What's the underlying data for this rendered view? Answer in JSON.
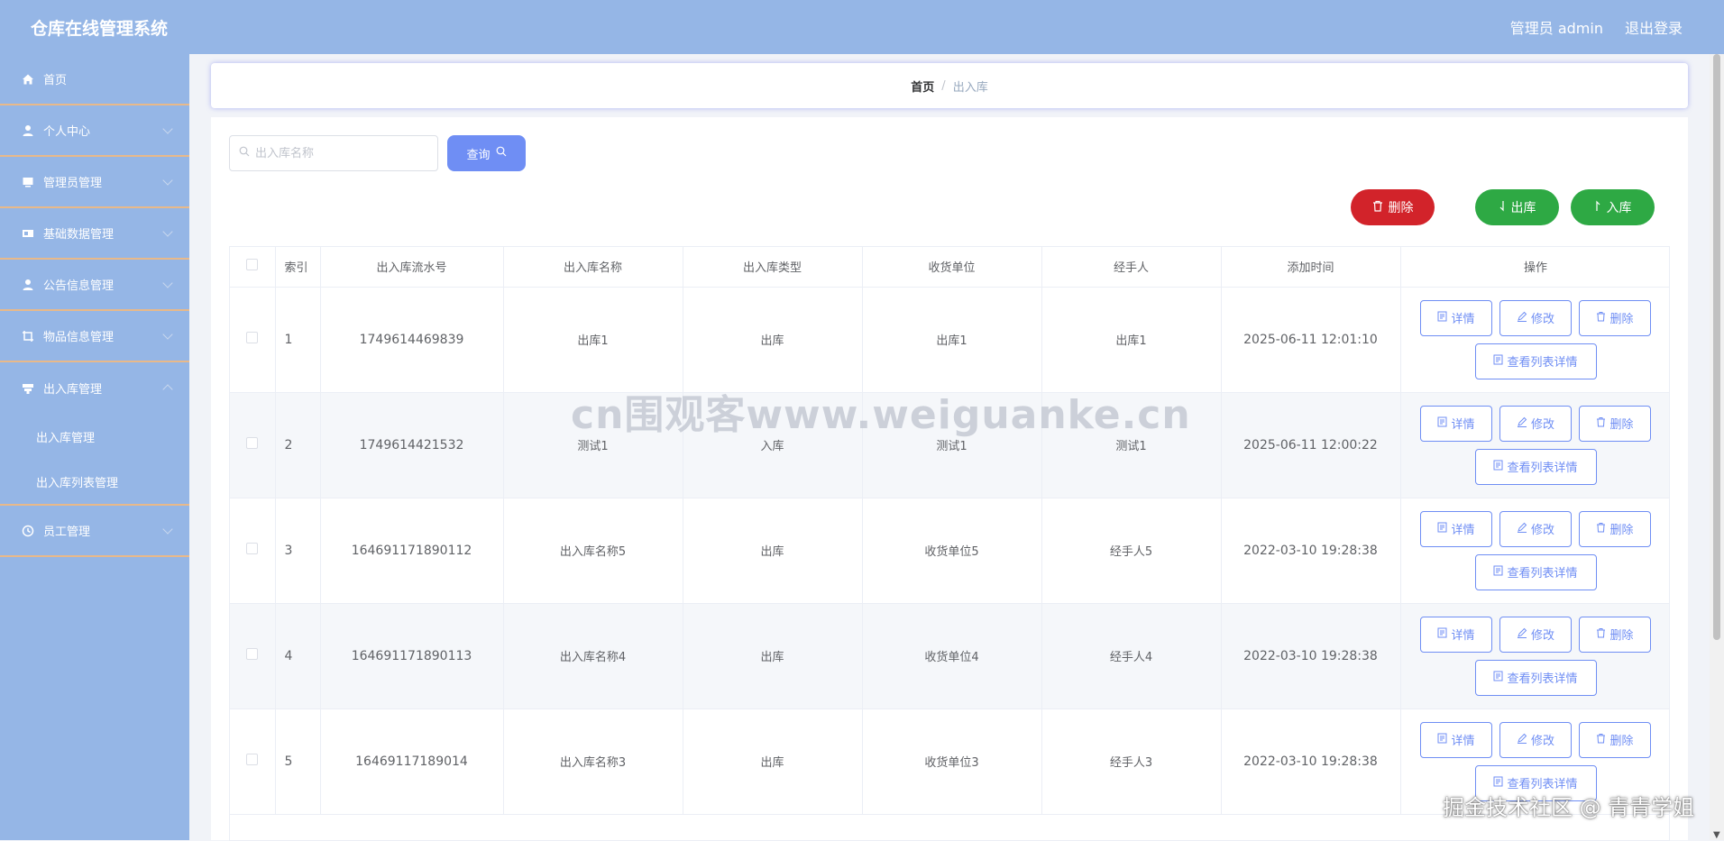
{
  "header": {
    "title": "仓库在线管理系统",
    "user": "管理员 admin",
    "logout": "退出登录"
  },
  "sidebar": {
    "items": [
      {
        "label": "首页",
        "icon": "home-icon"
      },
      {
        "label": "个人中心",
        "icon": "user-icon"
      },
      {
        "label": "管理员管理",
        "icon": "monitor-icon"
      },
      {
        "label": "基础数据管理",
        "icon": "film-icon"
      },
      {
        "label": "公告信息管理",
        "icon": "user-icon"
      },
      {
        "label": "物品信息管理",
        "icon": "crop-icon"
      },
      {
        "label": "出入库管理",
        "icon": "bank-icon"
      },
      {
        "label": "员工管理",
        "icon": "clock-icon"
      }
    ],
    "submenu": [
      "出入库管理",
      "出入库列表管理"
    ]
  },
  "breadcrumb": {
    "home": "首页",
    "separator": "/",
    "current": "出入库"
  },
  "search": {
    "placeholder": "出入库名称",
    "button": "查询"
  },
  "actions": {
    "delete": "删除",
    "outbound": "出库",
    "inbound": "入库"
  },
  "table": {
    "headers": [
      "索引",
      "出入库流水号",
      "出入库名称",
      "出入库类型",
      "收货单位",
      "经手人",
      "添加时间",
      "操作"
    ],
    "rows": [
      {
        "index": "1",
        "serial": "1749614469839",
        "name": "出库1",
        "type": "出库",
        "unit": "出库1",
        "handler": "出库1",
        "time": "2025-06-11 12:01:10"
      },
      {
        "index": "2",
        "serial": "1749614421532",
        "name": "测试1",
        "type": "入库",
        "unit": "测试1",
        "handler": "测试1",
        "time": "2025-06-11 12:00:22"
      },
      {
        "index": "3",
        "serial": "164691171890112",
        "name": "出入库名称5",
        "type": "出库",
        "unit": "收货单位5",
        "handler": "经手人5",
        "time": "2022-03-10 19:28:38"
      },
      {
        "index": "4",
        "serial": "164691171890113",
        "name": "出入库名称4",
        "type": "出库",
        "unit": "收货单位4",
        "handler": "经手人4",
        "time": "2022-03-10 19:28:38"
      },
      {
        "index": "5",
        "serial": "16469117189014",
        "name": "出入库名称3",
        "type": "出库",
        "unit": "收货单位3",
        "handler": "经手人3",
        "time": "2022-03-10 19:28:38"
      }
    ],
    "row_ops": {
      "detail": "详情",
      "edit": "修改",
      "delete": "删除",
      "list_detail": "查看列表详情"
    }
  },
  "watermark": "cn围观客www.weiguanke.cn",
  "footer_mark": "掘金技术社区 @ 青青学姐",
  "colors": {
    "header": "#95b6e6",
    "sidebar": "#95b6e6",
    "primary": "#6f8ef4",
    "danger": "#d2232a",
    "success": "#2ea944",
    "divider": "#e8b98a"
  }
}
